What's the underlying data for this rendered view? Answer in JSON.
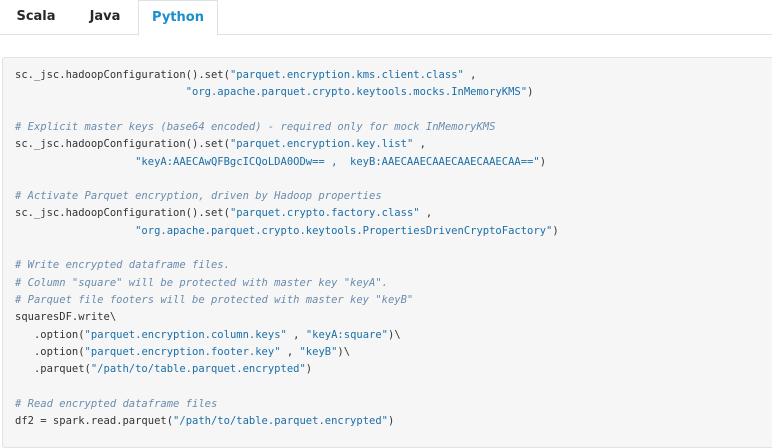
{
  "tabs": [
    {
      "label": "Scala",
      "active": false
    },
    {
      "label": "Java",
      "active": false
    },
    {
      "label": "Python",
      "active": true
    }
  ],
  "colors": {
    "active_tab": "#1a8fcc",
    "string": "#1a6fa8",
    "comment": "#6a8cae",
    "code_background": "#f6f6f6"
  },
  "code": {
    "language": "Python",
    "lines": [
      [
        {
          "t": "pln",
          "v": "sc._jsc.hadoopConfiguration().set("
        },
        {
          "t": "str",
          "v": "\"parquet.encryption.kms.client.class\""
        },
        {
          "t": "pln",
          "v": " ,"
        }
      ],
      [
        {
          "t": "pln",
          "v": "                           "
        },
        {
          "t": "str",
          "v": "\"org.apache.parquet.crypto.keytools.mocks.InMemoryKMS\""
        },
        {
          "t": "pln",
          "v": ")"
        }
      ],
      [],
      [
        {
          "t": "com",
          "v": "# Explicit master keys (base64 encoded) - required only for mock InMemoryKMS"
        }
      ],
      [
        {
          "t": "pln",
          "v": "sc._jsc.hadoopConfiguration().set("
        },
        {
          "t": "str",
          "v": "\"parquet.encryption.key.list\""
        },
        {
          "t": "pln",
          "v": " ,"
        }
      ],
      [
        {
          "t": "pln",
          "v": "                   "
        },
        {
          "t": "str",
          "v": "\"keyA:AAECAwQFBgcICQoLDA0ODw== ,  keyB:AAECAAECAAECAAECAAECAA==\""
        },
        {
          "t": "pln",
          "v": ")"
        }
      ],
      [],
      [
        {
          "t": "com",
          "v": "# Activate Parquet encryption, driven by Hadoop properties"
        }
      ],
      [
        {
          "t": "pln",
          "v": "sc._jsc.hadoopConfiguration().set("
        },
        {
          "t": "str",
          "v": "\"parquet.crypto.factory.class\""
        },
        {
          "t": "pln",
          "v": " ,"
        }
      ],
      [
        {
          "t": "pln",
          "v": "                   "
        },
        {
          "t": "str",
          "v": "\"org.apache.parquet.crypto.keytools.PropertiesDrivenCryptoFactory\""
        },
        {
          "t": "pln",
          "v": ")"
        }
      ],
      [],
      [
        {
          "t": "com",
          "v": "# Write encrypted dataframe files."
        }
      ],
      [
        {
          "t": "com",
          "v": "# Column \"square\" will be protected with master key \"keyA\"."
        }
      ],
      [
        {
          "t": "com",
          "v": "# Parquet file footers will be protected with master key \"keyB\""
        }
      ],
      [
        {
          "t": "pln",
          "v": "squaresDF.write\\"
        }
      ],
      [
        {
          "t": "pln",
          "v": "   .option("
        },
        {
          "t": "str",
          "v": "\"parquet.encryption.column.keys\""
        },
        {
          "t": "pln",
          "v": " , "
        },
        {
          "t": "str",
          "v": "\"keyA:square\""
        },
        {
          "t": "pln",
          "v": ")\\"
        }
      ],
      [
        {
          "t": "pln",
          "v": "   .option("
        },
        {
          "t": "str",
          "v": "\"parquet.encryption.footer.key\""
        },
        {
          "t": "pln",
          "v": " , "
        },
        {
          "t": "str",
          "v": "\"keyB\""
        },
        {
          "t": "pln",
          "v": ")\\"
        }
      ],
      [
        {
          "t": "pln",
          "v": "   .parquet("
        },
        {
          "t": "str",
          "v": "\"/path/to/table.parquet.encrypted\""
        },
        {
          "t": "pln",
          "v": ")"
        }
      ],
      [],
      [
        {
          "t": "com",
          "v": "# Read encrypted dataframe files"
        }
      ],
      [
        {
          "t": "pln",
          "v": "df2 = spark.read.parquet("
        },
        {
          "t": "str",
          "v": "\"/path/to/table.parquet.encrypted\""
        },
        {
          "t": "pln",
          "v": ")"
        }
      ]
    ]
  }
}
